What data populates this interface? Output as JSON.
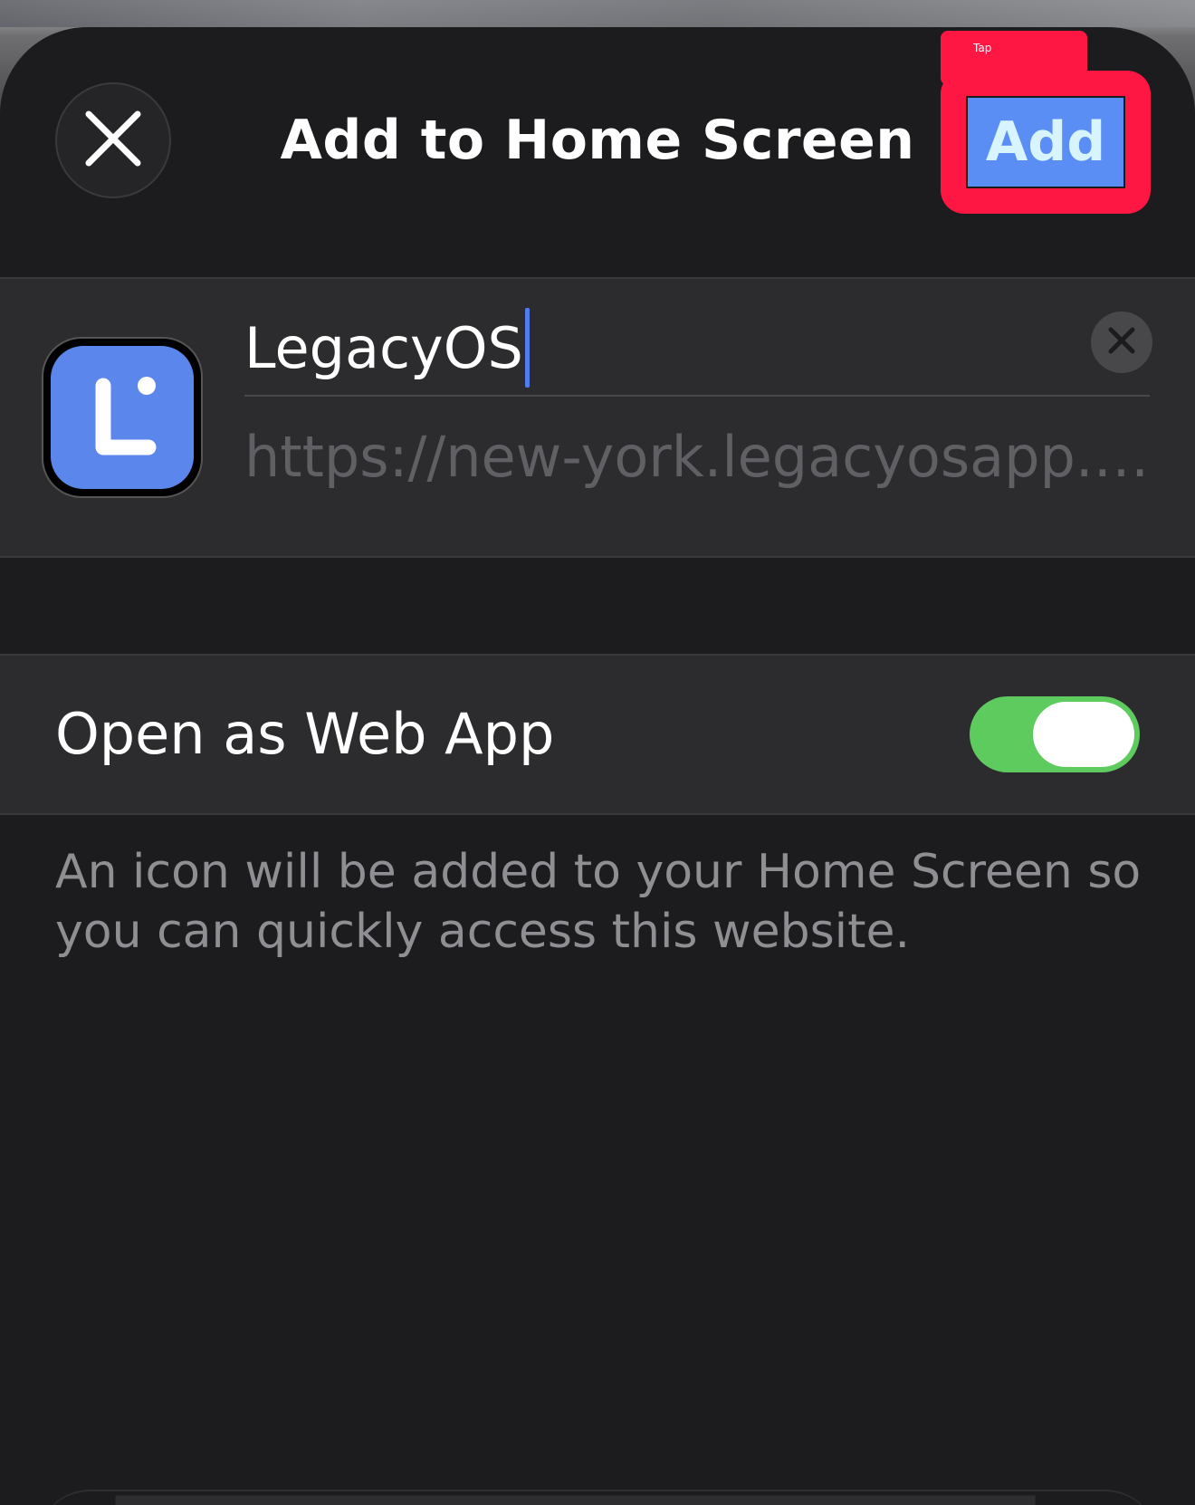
{
  "header": {
    "title": "Add to Home Screen",
    "add_label": "Add",
    "tap_hint": "Tap"
  },
  "icons": {
    "close": "close-icon",
    "clear": "clear-icon",
    "app": "app-icon"
  },
  "form": {
    "name_value": "LegacyOS",
    "url": "https://new-york.legacyosapp.c..."
  },
  "toggle": {
    "label": "Open as Web App",
    "on": true
  },
  "footnote": "An icon will be added to your Home Screen so you can quickly access this website.",
  "colors": {
    "sheet_bg": "#1c1c1e",
    "group_bg": "#2c2c2e",
    "accent_blue": "#5b8ef4",
    "toggle_green": "#5ecb5f",
    "highlight_red": "#ff1744"
  }
}
